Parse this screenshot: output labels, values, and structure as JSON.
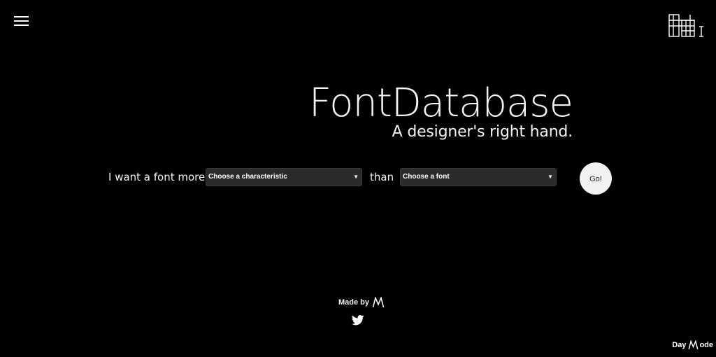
{
  "header": {
    "menu_icon": "hamburger-menu-icon",
    "logo_icon": "font-database-logo-icon"
  },
  "hero": {
    "title": "FontDatabase",
    "tagline": "A designer's right hand."
  },
  "query": {
    "prefix": "I want a font more",
    "characteristic_select": "Choose a characteristic",
    "connector": "than",
    "font_select": "Choose a font",
    "go_label": "Go!"
  },
  "footer": {
    "made_by": "Made by",
    "author_logo_icon": "m-logo-icon",
    "twitter_icon": "twitter-bird-icon"
  },
  "mode_toggle": {
    "prefix": "Day",
    "suffix": "ode",
    "icon": "m-logo-icon"
  },
  "colors": {
    "background": "#000000",
    "text": "#f3f3f3",
    "select_bg": "#2b2b2b",
    "button_bg": "#f2f2f2"
  }
}
